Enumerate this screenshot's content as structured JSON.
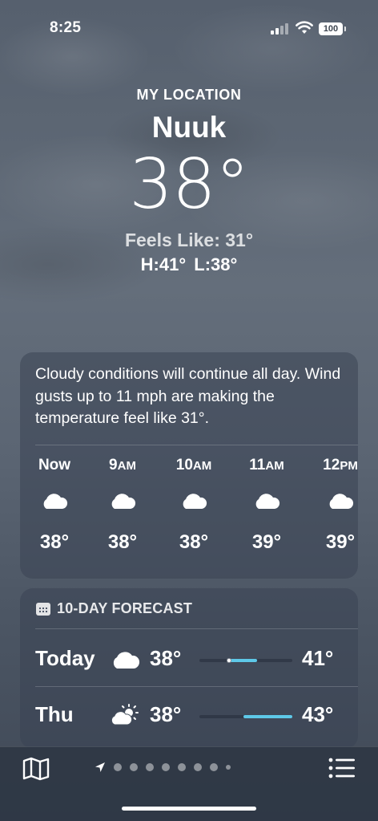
{
  "status_bar": {
    "time": "8:25",
    "battery": "100"
  },
  "header": {
    "location_label": "MY LOCATION",
    "city": "Nuuk",
    "temperature": "38°",
    "feels_like": "Feels Like: 31°",
    "hilo": "H:41°  L:38°"
  },
  "summary": {
    "text": "Cloudy conditions will continue all day. Wind gusts up to 11 mph are making the temperature feel like 31°.",
    "hours": [
      {
        "label": "Now",
        "icon": "cloud-icon",
        "temp": "38°"
      },
      {
        "label": "9AM",
        "icon": "cloud-icon",
        "temp": "38°"
      },
      {
        "label": "10AM",
        "icon": "cloud-icon",
        "temp": "38°"
      },
      {
        "label": "11AM",
        "icon": "cloud-icon",
        "temp": "39°"
      },
      {
        "label": "12PM",
        "icon": "cloud-icon",
        "temp": "39°"
      }
    ]
  },
  "forecast": {
    "title": "10-DAY FORECAST",
    "days": [
      {
        "day": "Today",
        "icon": "cloud-icon",
        "low": "38°",
        "high": "41°",
        "range_start": 0.32,
        "range_end": 0.62,
        "current_position": 0.32
      },
      {
        "day": "Thu",
        "icon": "partly-sunny-icon",
        "low": "38°",
        "high": "43°",
        "range_start": 0.47,
        "range_end": 1.0
      }
    ]
  },
  "bottom_bar": {
    "page_count": 9,
    "current_page": 0
  },
  "colors": {
    "accent": "#5ec8e8",
    "card": "#3a4454"
  }
}
